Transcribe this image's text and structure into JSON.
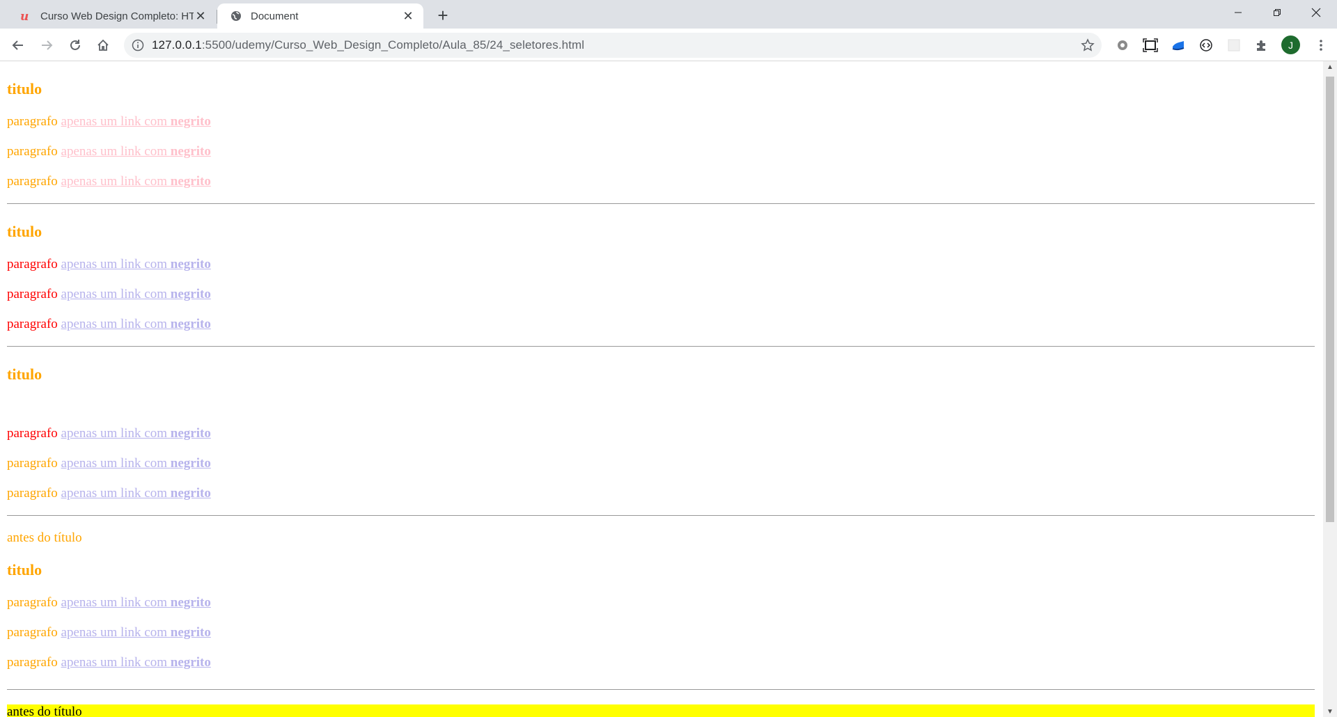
{
  "browser": {
    "tabs": [
      {
        "title": "Curso Web Design Completo: HT",
        "active": false
      },
      {
        "title": "Document",
        "active": true
      }
    ],
    "new_tab_label": "+",
    "address": {
      "host": "127.0.0.1",
      "path": ":5500/udemy/Curso_Web_Design_Completo/Aula_85/24_seletores.html"
    },
    "avatar_letter": "J",
    "close_glyph": "✕"
  },
  "page": {
    "sections": [
      {
        "title": "titulo",
        "paragraphs": [
          {
            "text": "paragrafo",
            "link": "apenas um link com",
            "bold": "negrito"
          },
          {
            "text": "paragrafo",
            "link": "apenas um link com",
            "bold": "negrito"
          },
          {
            "text": "paragrafo",
            "link": "apenas um link com",
            "bold": "negrito"
          }
        ]
      },
      {
        "title": "titulo",
        "paragraphs": [
          {
            "text": "paragrafo",
            "link": "apenas um link com",
            "bold": "negrito"
          },
          {
            "text": "paragrafo",
            "link": "apenas um link com",
            "bold": "negrito"
          },
          {
            "text": "paragrafo",
            "link": "apenas um link com",
            "bold": "negrito"
          }
        ]
      },
      {
        "title": "titulo",
        "paragraphs": [
          {
            "text": "paragrafo",
            "link": "apenas um link com",
            "bold": "negrito"
          },
          {
            "text": "paragrafo",
            "link": "apenas um link com",
            "bold": "negrito"
          },
          {
            "text": "paragrafo",
            "link": "apenas um link com",
            "bold": "negrito"
          }
        ]
      },
      {
        "before": "antes do título",
        "title": "titulo",
        "paragraphs": [
          {
            "text": "paragrafo",
            "link": "apenas um link com",
            "bold": "negrito"
          },
          {
            "text": "paragrafo",
            "link": "apenas um link com",
            "bold": "negrito"
          },
          {
            "text": "paragrafo",
            "link": "apenas um link com",
            "bold": "negrito"
          }
        ]
      }
    ],
    "final_before": "antes do título"
  },
  "colors": {
    "heading": "#ffa500",
    "orange_text": "#ffa500",
    "red_text": "#ff0000",
    "link_pink": "#ffc0cb",
    "link_lavender": "#b7b3ec",
    "highlight": "#ffff00"
  }
}
